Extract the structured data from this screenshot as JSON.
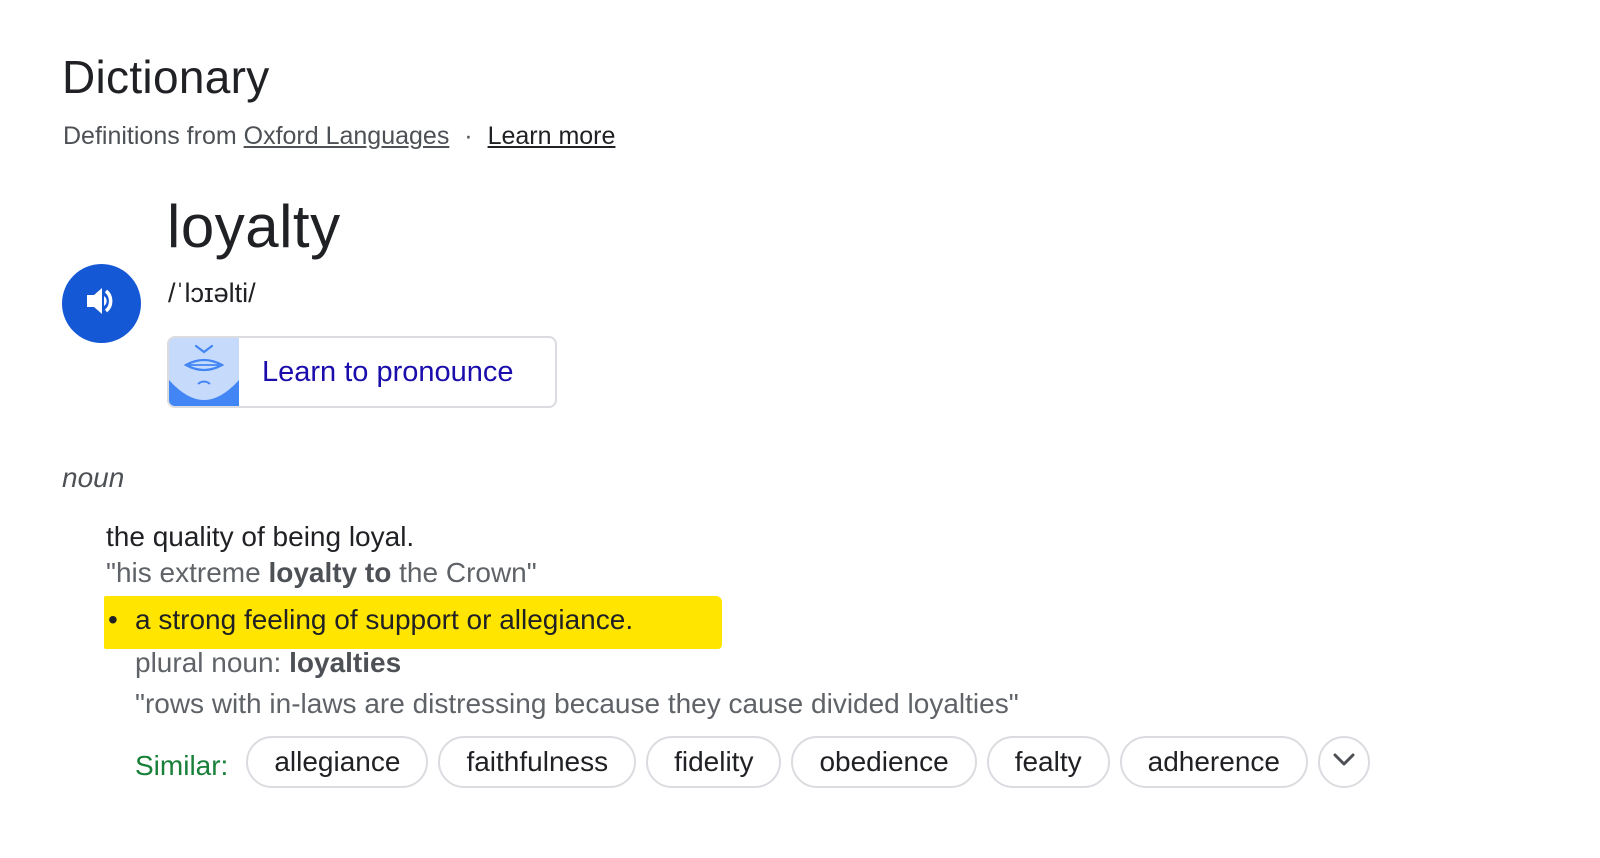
{
  "header": {
    "title": "Dictionary",
    "source_prefix": "Definitions from",
    "source_link": "Oxford Languages",
    "separator": "·",
    "learn_more": "Learn more"
  },
  "entry": {
    "word": "loyalty",
    "phonetic": "/ˈlɔɪəlti/",
    "speaker_icon": "speaker-icon",
    "pronounce_button": "Learn to pronounce",
    "pronounce_icon": "lips-face-icon",
    "part_of_speech": "noun",
    "definitions": [
      {
        "text": "the quality of being loyal.",
        "example_parts": [
          "\"his extreme ",
          "loyalty to",
          " the Crown\""
        ]
      },
      {
        "bullet": "•",
        "text": "a strong feeling of support or allegiance.",
        "highlighted": true,
        "plural_label": "plural noun:",
        "plural_value": "loyalties",
        "example": "\"rows with in-laws are distressing because they cause divided loyalties\""
      }
    ],
    "similar_label": "Similar:",
    "similar": [
      "allegiance",
      "faithfulness",
      "fidelity",
      "obedience",
      "fealty",
      "adherence"
    ],
    "expand_icon": "chevron-down-icon"
  },
  "colors": {
    "accent_blue": "#1558d6",
    "link_blue": "#1a0dab",
    "highlight_yellow": "#ffe500",
    "similar_green": "#188038"
  }
}
